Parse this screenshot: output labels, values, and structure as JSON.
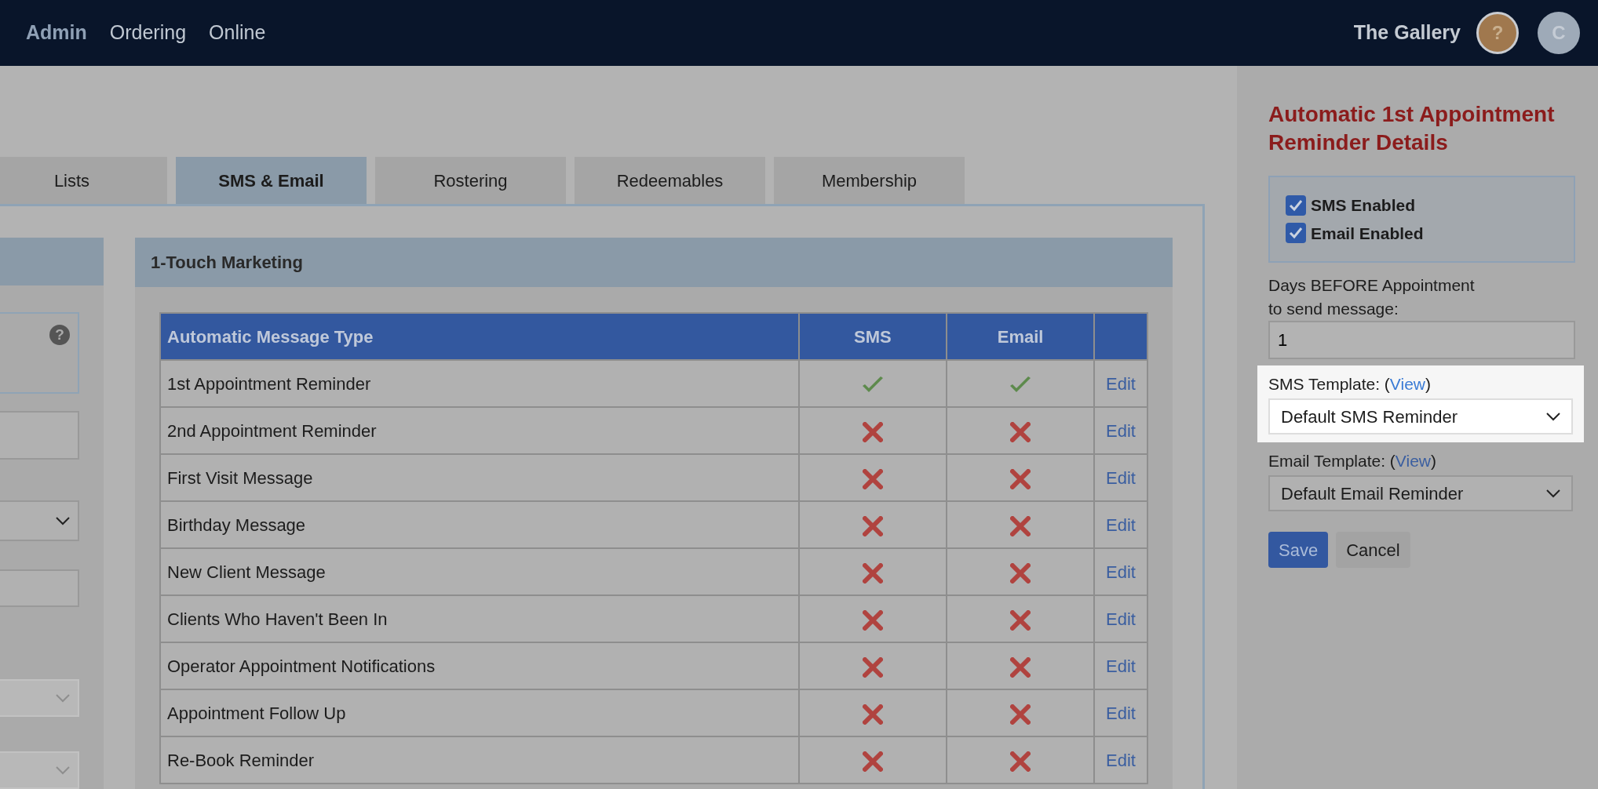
{
  "nav": {
    "links": [
      {
        "label": "Admin",
        "selected": true
      },
      {
        "label": "Ordering",
        "selected": false
      },
      {
        "label": "Online",
        "selected": false
      }
    ],
    "brand": "The Gallery",
    "help_avatar": "?",
    "user_avatar": "C"
  },
  "tabs": [
    {
      "label": "Lists",
      "selected": false
    },
    {
      "label": "SMS & Email",
      "selected": true
    },
    {
      "label": "Rostering",
      "selected": false
    },
    {
      "label": "Redeemables",
      "selected": false
    },
    {
      "label": "Membership",
      "selected": false
    }
  ],
  "left_panel": {
    "help_icon": "?",
    "fields": [
      {
        "kind": "input",
        "disabled": false
      },
      {
        "kind": "select",
        "disabled": false
      },
      {
        "kind": "input",
        "disabled": false
      },
      {
        "kind": "select",
        "disabled": true
      },
      {
        "kind": "select",
        "disabled": true
      }
    ]
  },
  "marketing": {
    "title": "1-Touch Marketing",
    "columns": [
      "Automatic Message Type",
      "SMS",
      "Email"
    ],
    "rows": [
      {
        "type": "1st Appointment Reminder",
        "sms": true,
        "email": true,
        "action": "Edit"
      },
      {
        "type": "2nd Appointment Reminder",
        "sms": false,
        "email": false,
        "action": "Edit"
      },
      {
        "type": "First Visit Message",
        "sms": false,
        "email": false,
        "action": "Edit"
      },
      {
        "type": "Birthday Message",
        "sms": false,
        "email": false,
        "action": "Edit"
      },
      {
        "type": "New Client Message",
        "sms": false,
        "email": false,
        "action": "Edit"
      },
      {
        "type": "Clients Who Haven't Been In",
        "sms": false,
        "email": false,
        "action": "Edit"
      },
      {
        "type": "Operator Appointment Notifications",
        "sms": false,
        "email": false,
        "action": "Edit"
      },
      {
        "type": "Appointment Follow Up",
        "sms": false,
        "email": false,
        "action": "Edit"
      },
      {
        "type": "Re-Book Reminder",
        "sms": false,
        "email": false,
        "action": "Edit"
      }
    ]
  },
  "details": {
    "title": "Automatic 1st Appointment Reminder Details",
    "checkboxes": [
      {
        "label": "SMS Enabled",
        "checked": true
      },
      {
        "label": "Email Enabled",
        "checked": true
      }
    ],
    "days_label": "Days BEFORE Appointment to send message:",
    "days_value": "1",
    "templates": [
      {
        "label": "SMS Template: (",
        "link": "View",
        "label_end": ")",
        "value": "Default SMS Reminder",
        "highlighted": true
      },
      {
        "label": "Email Template: (",
        "link": "View",
        "label_end": ")",
        "value": "Default Email Reminder",
        "highlighted": false
      }
    ],
    "buttons": [
      {
        "label": "Save",
        "kind": "primary"
      },
      {
        "label": "Cancel",
        "kind": "secondary"
      }
    ]
  }
}
